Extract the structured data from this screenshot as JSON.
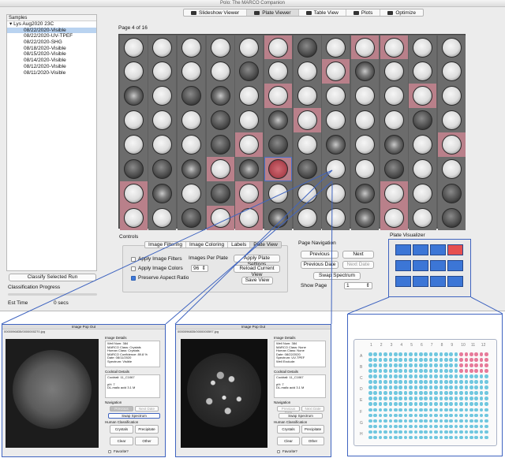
{
  "window": {
    "title": "Polo: The MARCO Companion",
    "tabs": [
      {
        "label": "Slideshow Viewer",
        "icon": "slideshow-icon",
        "active": false
      },
      {
        "label": "Plate Viewer",
        "icon": "plate-icon",
        "active": true
      },
      {
        "label": "Table View",
        "icon": "table-icon",
        "active": false
      },
      {
        "label": "Plots",
        "icon": "plots-icon",
        "active": false
      },
      {
        "label": "Optimize",
        "icon": "optimize-icon",
        "active": false
      }
    ]
  },
  "sidebar": {
    "header": "Samples",
    "root": "Lys Aug2020 23C",
    "items": [
      {
        "label": "08/22/2020-Visible",
        "selected": true
      },
      {
        "label": "08/22/2020-UV-TPEF",
        "selected": false
      },
      {
        "label": "08/22/2020-SHG",
        "selected": false
      },
      {
        "label": "08/18/2020-Visible",
        "selected": false
      },
      {
        "label": "08/15/2020-Visible",
        "selected": false
      },
      {
        "label": "08/14/2020-Visible",
        "selected": false
      },
      {
        "label": "08/12/2020-Visible",
        "selected": false
      },
      {
        "label": "08/11/2020-Visible",
        "selected": false
      }
    ],
    "classify_button": "Classify Selected Run",
    "progress_label": "Classification Progress",
    "est_label": "Est Time",
    "est_value": "0 secs"
  },
  "plate": {
    "page_label": "Page 4 of 16",
    "highlighted_wells": [
      5,
      8,
      9,
      19,
      29,
      34,
      42,
      52,
      59,
      63,
      65,
      72,
      76,
      81,
      84,
      87,
      88,
      93,
      98,
      101,
      103,
      105,
      106
    ],
    "dark_wells": [
      6,
      16,
      26,
      39,
      46,
      51,
      53,
      60,
      61,
      66,
      69,
      75,
      83,
      86,
      95
    ],
    "crystal_wells": [
      20,
      24,
      27,
      41,
      55,
      57,
      62,
      64,
      73,
      80,
      89,
      92,
      96,
      100,
      104
    ],
    "red_wells": [
      65
    ],
    "selected_well": 65
  },
  "controls": {
    "section_label": "Controls",
    "tabs": [
      {
        "label": "Image Filtering",
        "active": false
      },
      {
        "label": "Image Coloring",
        "active": false
      },
      {
        "label": "Labels",
        "active": false
      },
      {
        "label": "Plate View",
        "active": true
      }
    ],
    "apply_filters": {
      "label": "Apply Image Filters",
      "checked": false
    },
    "apply_colors": {
      "label": "Apply Image Colors",
      "checked": false
    },
    "preserve_aspect": {
      "label": "Preserve Aspect Ratio",
      "checked": true
    },
    "images_per_plate_label": "Images Per Plate",
    "images_per_plate_value": "96",
    "apply_settings_button": "Apply Plate Settings",
    "reload_button": "Reload Current View",
    "save_button": "Save View"
  },
  "navigation": {
    "label": "Page Navigation",
    "previous": "Previous",
    "next": "Next",
    "previous_date": "Previous Date",
    "next_date": "Next Date",
    "swap": "Swap Spectrum",
    "show_page_label": "Show Page",
    "show_page_value": "1"
  },
  "visualizer": {
    "label": "Plate Visualizer",
    "active_cell": 3
  },
  "popouts": [
    {
      "title": "Image Pop Out",
      "path": "0000096835/0000000270.jpg",
      "details_label": "Image Details",
      "details": [
        "Well Num: 384",
        "MARCO Class: Crystals",
        "Human Class: Crystals",
        "MARCO Confidence: 89.8 %",
        "Date: 08/11/2020",
        "Spectrum: Visible"
      ],
      "cocktail_label": "Cocktail Details",
      "cocktail": [
        "Cocktail: 11_C1067",
        "pH: 7",
        "DL-malic acid 3.1 M"
      ],
      "nav_label": "Navigation",
      "prev": "Previous Date",
      "next": "Next Date",
      "swap": "Swap Spectrum",
      "hc_label": "Human Classification",
      "crystals": "Crystals",
      "precipitate": "Precipitate",
      "clear": "Clear",
      "other": "Other",
      "favorite": "Favorite?"
    },
    {
      "title": "Image Pop Out",
      "path": "0000096835/0000000597.jpg",
      "details_label": "Image Details",
      "details": [
        "Well Num: 384",
        "MARCO Class: None",
        "Human Class: None",
        "Date: 08/22/2020",
        "Spectrum: UV-TPEF",
        "Well Exclude:"
      ],
      "cocktail_label": "Cocktail Details",
      "cocktail": [
        "Cocktail: 11_C1067",
        "pH: 7",
        "DL-malic acid 3.1 M"
      ],
      "nav_label": "Navigation",
      "prev": "Previous Date",
      "next": "Next Date",
      "swap": "Swap Spectrum",
      "hc_label": "Human Classification",
      "crystals": "Crystals",
      "precipitate": "Precipitate",
      "clear": "Clear",
      "other": "Other",
      "favorite": "Favorite?"
    }
  ],
  "big_plate": {
    "col_labels": [
      "1",
      "2",
      "3",
      "4",
      "5",
      "6",
      "7",
      "8",
      "9",
      "10",
      "11",
      "12"
    ],
    "row_labels": [
      "A",
      "B",
      "C",
      "D",
      "E",
      "F",
      "G",
      "H"
    ],
    "well_color": "#6fc7df",
    "highlight_color": "#e77a99"
  },
  "colors": {
    "accent": "#3f64c0",
    "highlight_well": "#b9808a",
    "visualizer_cell": "#3c76d6",
    "visualizer_active": "#e65050"
  }
}
